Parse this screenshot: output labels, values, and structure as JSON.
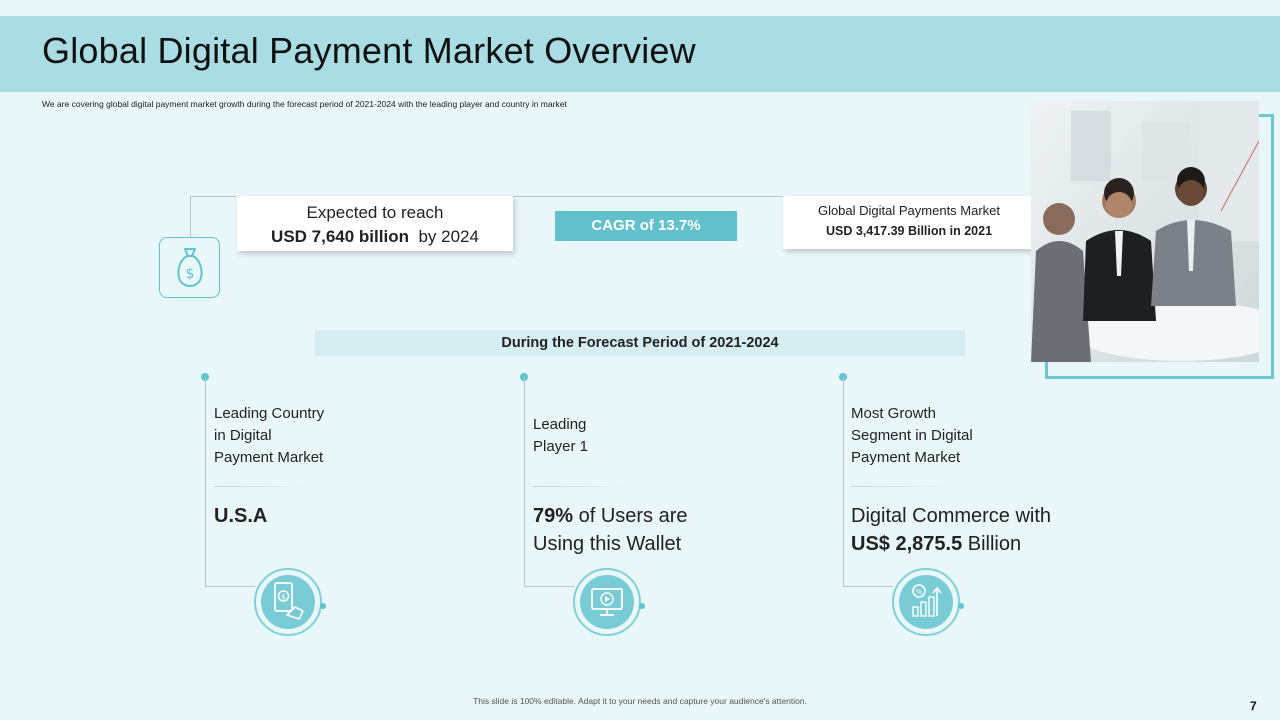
{
  "slide": {
    "title": "Global Digital Payment Market Overview",
    "subtitle": "We are covering global digital payment market growth during the forecast period of 2021-2024 with the leading player and country in market",
    "footer": "This slide is 100% editable. Adapt it to your needs and capture your audience's attention.",
    "page_number": "7"
  },
  "expected": {
    "line1": "Expected to reach",
    "value": "USD 7,640 billion",
    "suffix": "by 2024"
  },
  "cagr": {
    "label": "CAGR of 13.7%"
  },
  "market": {
    "line1": "Global Digital Payments Market",
    "line2": "USD 3,417.39 Billion in 2021"
  },
  "forecast": {
    "label": "During the Forecast Period of 2021-2024"
  },
  "columns": [
    {
      "head": [
        "Leading Country",
        "in Digital",
        "Payment Market"
      ],
      "value_bold": "U.S.A",
      "value_rest": "",
      "value_line2_bold": "",
      "value_line2_rest": "",
      "icon": "mobile-payment-icon"
    },
    {
      "head": [
        "Leading",
        "Player 1"
      ],
      "value_bold": "79%",
      "value_rest": " of Users are",
      "value_line2_bold": "",
      "value_line2_rest": "Using this Wallet",
      "icon": "monitor-play-icon"
    },
    {
      "head": [
        "Most Growth",
        "Segment in Digital",
        "Payment Market"
      ],
      "value_bold": "",
      "value_rest": "Digital Commerce with",
      "value_line2_bold": "US$ 2,875.5",
      "value_line2_rest": " Billion",
      "icon": "growth-chart-icon"
    }
  ],
  "icons": {
    "money": "money-bag-icon"
  },
  "colors": {
    "title_bar": "#a9dde3",
    "accent": "#62c0cc",
    "background": "#e9f6fa"
  }
}
